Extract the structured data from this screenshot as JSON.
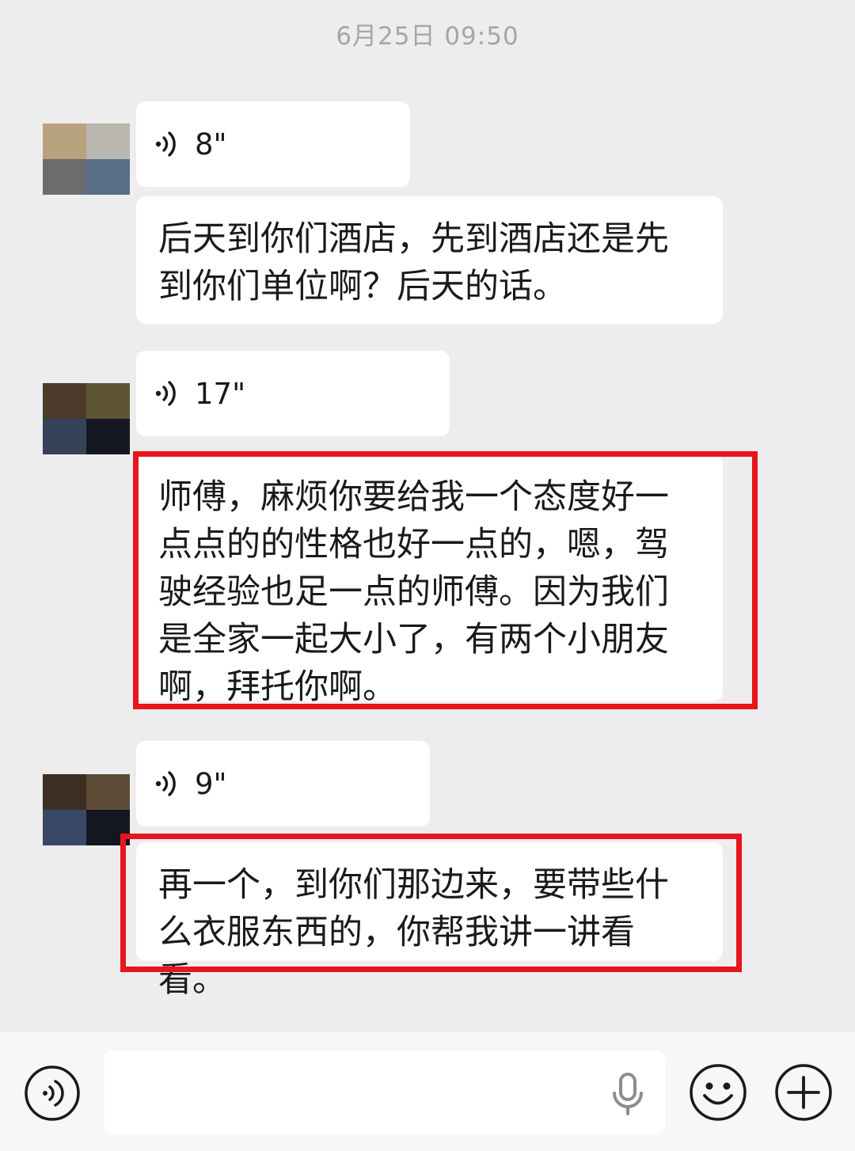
{
  "chat": {
    "timestamp": "6月25日 09:50",
    "messages": [
      {
        "type": "voice",
        "duration": "8\""
      },
      {
        "type": "text",
        "content": "后天到你们酒店，先到酒店还是先到你们单位啊？后天的话。"
      },
      {
        "type": "voice",
        "duration": "17\""
      },
      {
        "type": "text",
        "content": "师傅，麻烦你要给我一个态度好一点点的的性格也好一点的，嗯，驾驶经验也足一点的师傅。因为我们是全家一起大小了，有两个小朋友啊，拜托你啊。"
      },
      {
        "type": "voice",
        "duration": "9\""
      },
      {
        "type": "text",
        "content": "再一个，到你们那边来，要带些什么衣服东西的，你帮我讲一讲看看。"
      }
    ]
  },
  "input_bar": {
    "voice_mode_icon": "voice-mode-icon",
    "microphone_icon": "microphone-icon",
    "emoji_icon": "emoji-icon",
    "plus_icon": "plus-icon"
  },
  "colors": {
    "background": "#ededed",
    "bubble": "#ffffff",
    "highlight": "#e5161c",
    "timestamp": "#a6a6a6"
  }
}
